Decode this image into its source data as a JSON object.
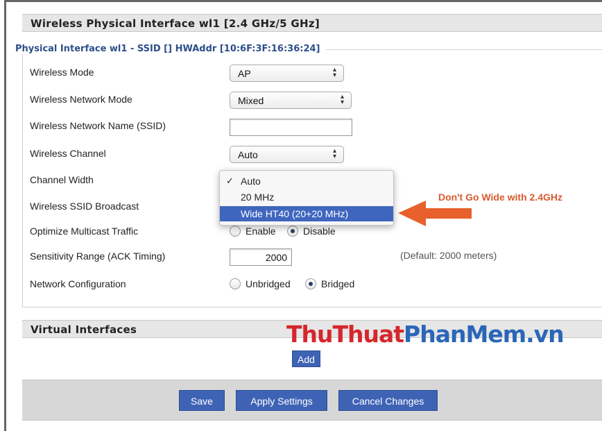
{
  "section1": {
    "title": "Wireless Physical Interface wl1 [2.4 GHz/5 GHz]"
  },
  "legend": "Physical Interface wl1 - SSID [] HWAddr [10:6F:3F:16:36:24]",
  "fields": {
    "wireless_mode": {
      "label": "Wireless Mode",
      "value": "AP"
    },
    "network_mode": {
      "label": "Wireless Network Mode",
      "value": "Mixed"
    },
    "ssid": {
      "label": "Wireless Network Name (SSID)",
      "value": ""
    },
    "channel": {
      "label": "Wireless Channel",
      "value": "Auto"
    },
    "channel_width": {
      "label": "Channel Width",
      "options": [
        "Auto",
        "20 MHz",
        "Wide HT40 (20+20 MHz)"
      ],
      "checked": "Auto",
      "highlighted": "Wide HT40 (20+20 MHz)"
    },
    "ssid_broadcast": {
      "label": "Wireless SSID Broadcast"
    },
    "multicast": {
      "label": "Optimize Multicast Traffic",
      "opt1": "Enable",
      "opt2": "Disable",
      "selected": "Disable"
    },
    "sensitivity": {
      "label": "Sensitivity Range (ACK Timing)",
      "value": "2000",
      "hint": "(Default: 2000 meters)"
    },
    "network_config": {
      "label": "Network Configuration",
      "opt1": "Unbridged",
      "opt2": "Bridged",
      "selected": "Bridged"
    }
  },
  "annotation": {
    "text": "Don't Go Wide with 2.4GHz",
    "color": "#d85a2d"
  },
  "section2": {
    "title": "Virtual Interfaces",
    "add_label": "Add"
  },
  "watermark": {
    "part1": "ThuThuat",
    "part2": "PhanMem.vn"
  },
  "footer": {
    "save": "Save",
    "apply": "Apply Settings",
    "cancel": "Cancel Changes"
  },
  "colors": {
    "accent": "#3f63b4",
    "legend": "#2d4f8a",
    "highlight": "#3f66bf"
  },
  "icons": {
    "select_arrows": "updown-arrows-icon",
    "check": "checkmark-icon",
    "arrow": "left-arrow-icon"
  }
}
